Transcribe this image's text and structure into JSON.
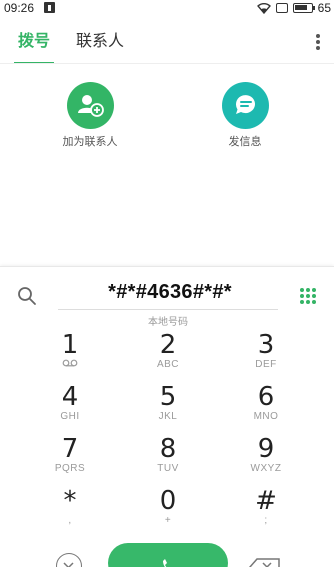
{
  "status_bar": {
    "time": "09:26",
    "battery_level": "65",
    "icons": [
      "notification-icon",
      "wifi-icon",
      "screen-cast-icon",
      "battery-icon"
    ]
  },
  "tabs": [
    {
      "label": "拨号",
      "active": true
    },
    {
      "label": "联系人",
      "active": false
    }
  ],
  "actions": {
    "add_contact": {
      "label": "加为联系人",
      "icon": "add-person-icon",
      "color": "#33b566"
    },
    "send_message": {
      "label": "发信息",
      "icon": "message-bubble-icon",
      "color": "#1db9b0"
    }
  },
  "dialer": {
    "number": "*#*#4636#*#*",
    "subtitle": "本地号码",
    "keys": [
      {
        "digit": "1",
        "letters": "voicemail"
      },
      {
        "digit": "2",
        "letters": "ABC"
      },
      {
        "digit": "3",
        "letters": "DEF"
      },
      {
        "digit": "4",
        "letters": "GHI"
      },
      {
        "digit": "5",
        "letters": "JKL"
      },
      {
        "digit": "6",
        "letters": "MNO"
      },
      {
        "digit": "7",
        "letters": "PQRS"
      },
      {
        "digit": "8",
        "letters": "TUV"
      },
      {
        "digit": "9",
        "letters": "WXYZ"
      },
      {
        "digit": "*",
        "letters": ","
      },
      {
        "digit": "0",
        "letters": "+"
      },
      {
        "digit": "#",
        "letters": ";"
      }
    ]
  },
  "colors": {
    "accent": "#34b466",
    "call_button": "#37b86a"
  }
}
